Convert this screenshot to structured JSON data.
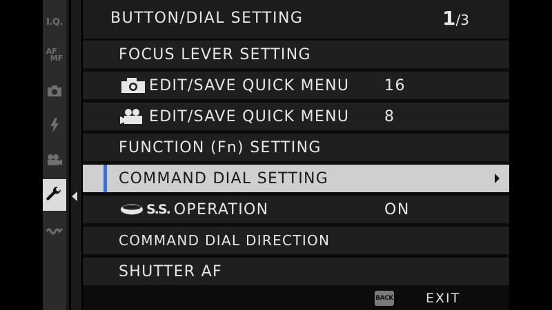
{
  "header": {
    "title": "BUTTON/DIAL SETTING",
    "page_current": "1",
    "page_total": "/3"
  },
  "tabs": [
    {
      "label": "I.Q.",
      "icon": "image-quality-icon"
    },
    {
      "label": "AF",
      "label2": "MF",
      "icon": "af-mf-icon"
    },
    {
      "label": "",
      "icon": "camera-icon"
    },
    {
      "label": "",
      "icon": "flash-icon"
    },
    {
      "label": "",
      "icon": "movie-icon"
    },
    {
      "label": "",
      "icon": "wrench-icon",
      "active": true
    },
    {
      "label": "",
      "icon": "connection-icon"
    }
  ],
  "menu": {
    "items": [
      {
        "label": "FOCUS LEVER SETTING",
        "value": ""
      },
      {
        "label": "EDIT/SAVE QUICK MENU",
        "value": "16",
        "icon": "camera-icon"
      },
      {
        "label": "EDIT/SAVE QUICK MENU",
        "value": "8",
        "icon": "movie-camera-icon"
      },
      {
        "label": "FUNCTION (Fn) SETTING",
        "value": ""
      },
      {
        "label": "COMMAND DIAL SETTING",
        "value": "",
        "selected": true
      },
      {
        "label": "OPERATION",
        "value": "ON",
        "icon": "dial-ss-icon",
        "icon_text": "S.S."
      },
      {
        "label": "COMMAND DIAL DIRECTION",
        "value": ""
      },
      {
        "label": "SHUTTER AF",
        "value": ""
      }
    ]
  },
  "footer": {
    "back_label": "BACK",
    "exit_label": "EXIT"
  },
  "colors": {
    "accent": "#3a6fd8",
    "selected_row": "#cfcfcf",
    "row": "#1f1f1f"
  }
}
